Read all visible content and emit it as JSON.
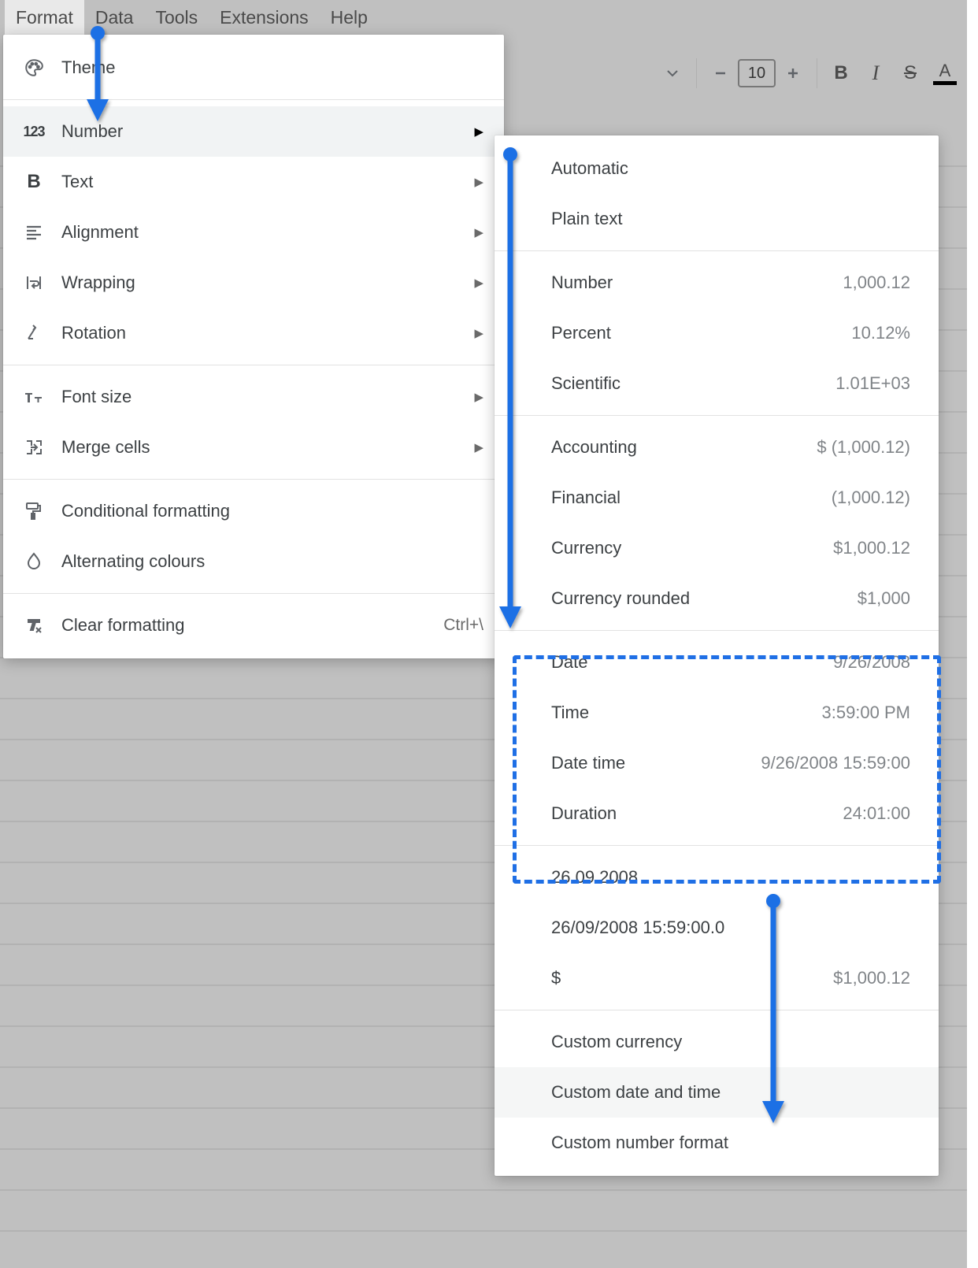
{
  "menubar": {
    "format": "Format",
    "data": "Data",
    "tools": "Tools",
    "extensions": "Extensions",
    "help": "Help"
  },
  "toolbar": {
    "font_size_value": "10"
  },
  "format_menu": {
    "theme": "Theme",
    "number": "Number",
    "text": "Text",
    "alignment": "Alignment",
    "wrapping": "Wrapping",
    "rotation": "Rotation",
    "font_size": "Font size",
    "merge_cells": "Merge cells",
    "conditional_formatting": "Conditional formatting",
    "alternating_colours": "Alternating colours",
    "clear_formatting": "Clear formatting",
    "clear_formatting_shortcut": "Ctrl+\\"
  },
  "number_menu": {
    "automatic": "Automatic",
    "plain_text": "Plain text",
    "number": {
      "label": "Number",
      "example": "1,000.12"
    },
    "percent": {
      "label": "Percent",
      "example": "10.12%"
    },
    "scientific": {
      "label": "Scientific",
      "example": "1.01E+03"
    },
    "accounting": {
      "label": "Accounting",
      "example": "$ (1,000.12)"
    },
    "financial": {
      "label": "Financial",
      "example": "(1,000.12)"
    },
    "currency": {
      "label": "Currency",
      "example": "$1,000.12"
    },
    "currency_rounded": {
      "label": "Currency rounded",
      "example": "$1,000"
    },
    "date": {
      "label": "Date",
      "example": "9/26/2008"
    },
    "time": {
      "label": "Time",
      "example": "3:59:00 PM"
    },
    "date_time": {
      "label": "Date time",
      "example": "9/26/2008 15:59:00"
    },
    "duration": {
      "label": "Duration",
      "example": "24:01:00"
    },
    "recent1": "26.09.2008",
    "recent2": "26/09/2008 15:59:00.0",
    "recent3": {
      "label": "$",
      "example": "$1,000.12"
    },
    "custom_currency": "Custom currency",
    "custom_date_time": "Custom date and time",
    "custom_number_format": "Custom number format"
  }
}
